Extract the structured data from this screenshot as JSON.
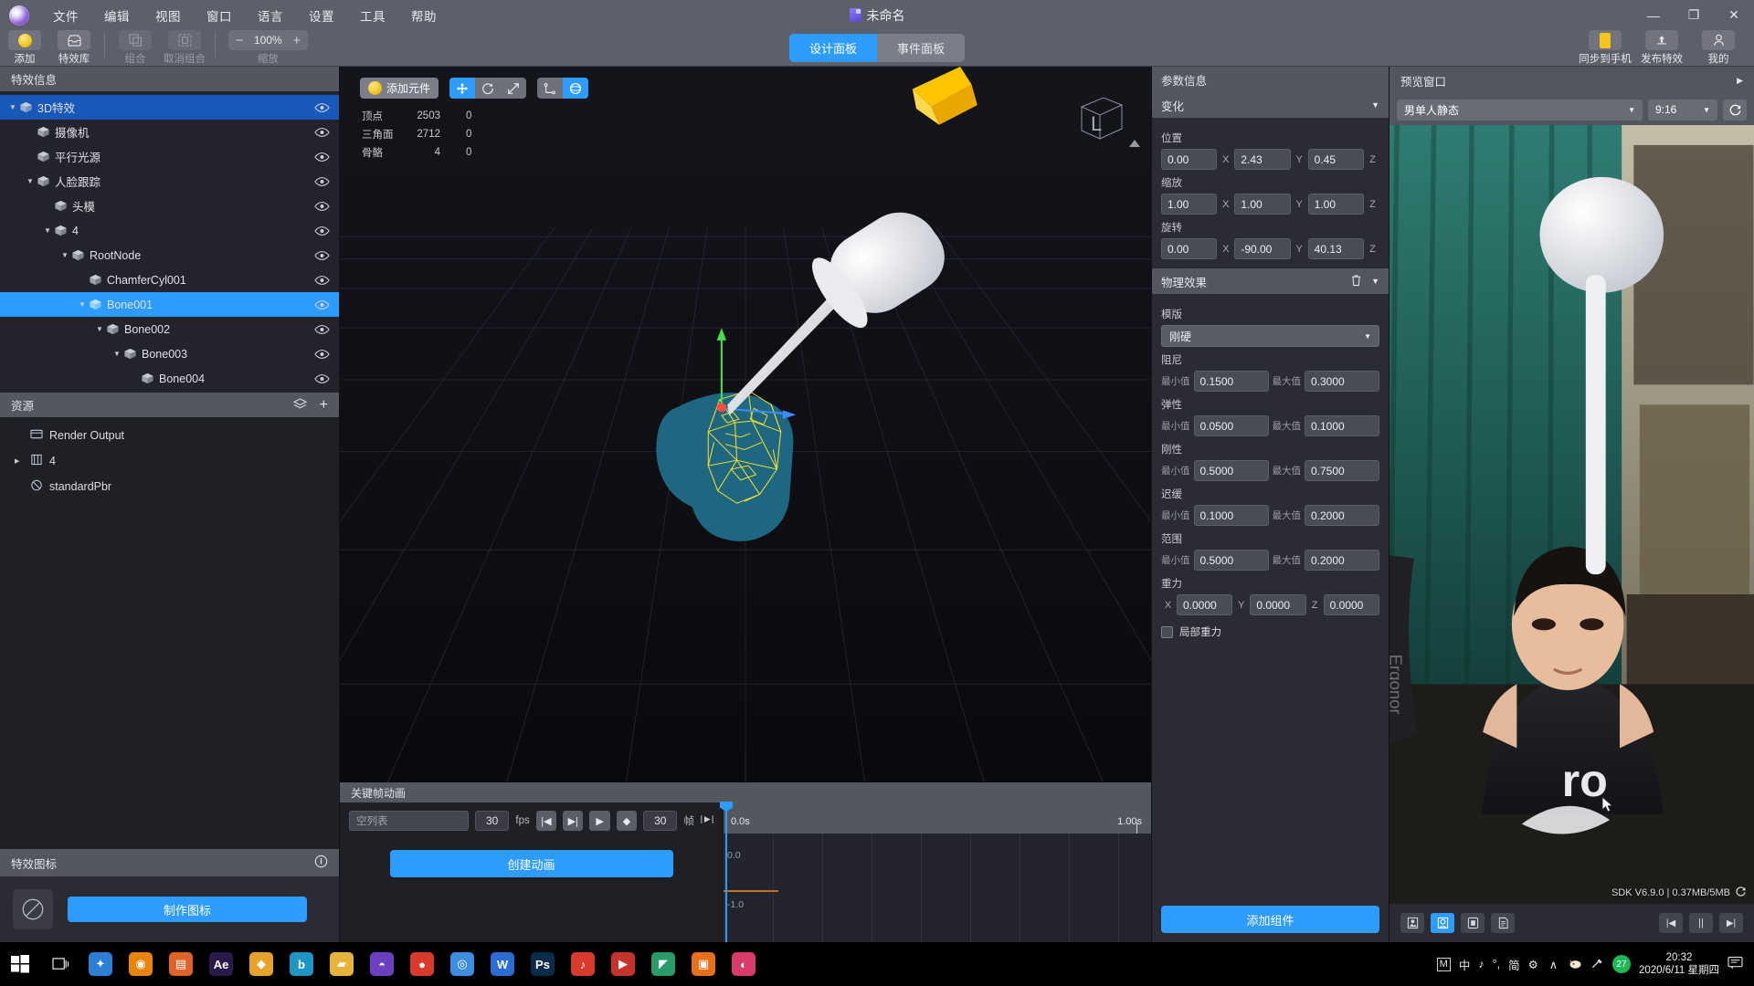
{
  "titlebar": {
    "menus": [
      "文件",
      "编辑",
      "视图",
      "窗口",
      "语言",
      "设置",
      "工具",
      "帮助"
    ],
    "document_title": "未命名",
    "minimize": "—",
    "maximize": "❐",
    "close": "✕"
  },
  "toolbar": {
    "items": [
      {
        "label": "添加",
        "icon": "coin-icon",
        "enabled": true
      },
      {
        "label": "特效库",
        "icon": "library-icon",
        "enabled": true
      },
      {
        "label": "组合",
        "icon": "group-icon",
        "enabled": false
      },
      {
        "label": "取消组合",
        "icon": "ungroup-icon",
        "enabled": false
      }
    ],
    "zoom_value": "100%",
    "zoom_minus": "−",
    "zoom_plus": "+",
    "zoom_label": "缩放",
    "tabs": [
      {
        "label": "设计面板",
        "active": true
      },
      {
        "label": "事件面板",
        "active": false
      }
    ],
    "right_items": [
      {
        "label": "同步到手机",
        "icon": "phone-icon"
      },
      {
        "label": "发布特效",
        "icon": "upload-icon"
      },
      {
        "label": "我的",
        "icon": "user-icon"
      }
    ]
  },
  "left_panel": {
    "header": "特效信息",
    "tree": [
      {
        "label": "3D特效",
        "depth": 0,
        "arrow": "▼",
        "state": "selected-dark",
        "eye": true
      },
      {
        "label": "摄像机",
        "depth": 1,
        "arrow": "",
        "state": "",
        "eye": true
      },
      {
        "label": "平行光源",
        "depth": 1,
        "arrow": "",
        "state": "",
        "eye": true
      },
      {
        "label": "人脸跟踪",
        "depth": 1,
        "arrow": "▼",
        "state": "",
        "eye": true
      },
      {
        "label": "头模",
        "depth": 2,
        "arrow": "",
        "state": "",
        "eye": true
      },
      {
        "label": "4",
        "depth": 2,
        "arrow": "▼",
        "state": "",
        "eye": true
      },
      {
        "label": "RootNode",
        "depth": 3,
        "arrow": "▼",
        "state": "",
        "eye": true
      },
      {
        "label": "ChamferCyl001",
        "depth": 4,
        "arrow": "",
        "state": "",
        "eye": true
      },
      {
        "label": "Bone001",
        "depth": 4,
        "arrow": "▼",
        "state": "selected",
        "eye": true
      },
      {
        "label": "Bone002",
        "depth": 5,
        "arrow": "▼",
        "state": "",
        "eye": true
      },
      {
        "label": "Bone003",
        "depth": 6,
        "arrow": "▼",
        "state": "",
        "eye": true
      },
      {
        "label": "Bone004",
        "depth": 7,
        "arrow": "",
        "state": "",
        "eye": true
      }
    ],
    "resources_header": "资源",
    "resources_icons": [
      "layers-icon",
      "plus-icon"
    ],
    "resources": [
      {
        "label": "Render Output",
        "icon": "render-icon",
        "arrow": ""
      },
      {
        "label": "4",
        "icon": "model-icon",
        "arrow": "▶"
      },
      {
        "label": "standardPbr",
        "icon": "material-icon",
        "arrow": ""
      }
    ],
    "goal_header": "特效图标",
    "goal_info_icon": "info-icon",
    "goal_button": "制作图标"
  },
  "viewport": {
    "add_element_button": "添加元件",
    "transform_tools": [
      {
        "name": "move-tool",
        "icon": "✥",
        "active": true
      },
      {
        "name": "rotate-tool",
        "icon": "↻",
        "active": false
      },
      {
        "name": "scale-tool",
        "icon": "⤢",
        "active": false
      }
    ],
    "space_tools": [
      {
        "name": "local-axis-tool",
        "icon": "⌖",
        "active": false
      },
      {
        "name": "world-axis-tool",
        "icon": "◍",
        "active": true
      }
    ],
    "stats": [
      {
        "key": "顶点",
        "value": "2503",
        "value2": "0"
      },
      {
        "key": "三角面",
        "value": "2712",
        "value2": "0"
      },
      {
        "key": "骨骼",
        "value": "4",
        "value2": "0"
      }
    ],
    "gizmo_label": "L"
  },
  "timeline": {
    "header": "关键帧动画",
    "clip_name_placeholder": "空列表",
    "fps_value": "30",
    "fps_label": "fps",
    "buttons": [
      {
        "name": "prev-frame-button",
        "icon": "|◀"
      },
      {
        "name": "next-frame-button",
        "icon": "▶|"
      },
      {
        "name": "play-button",
        "icon": "▶"
      },
      {
        "name": "add-keyframe-button",
        "icon": "◆"
      }
    ],
    "frame_value": "30",
    "frame_label": "帧",
    "loop_icon": "loop-icon",
    "create_button": "创建动画",
    "time_start": "0.0s",
    "time_end": "1.00s",
    "axis_labels": [
      "0.0",
      "-1.0"
    ]
  },
  "params": {
    "header": "参数信息",
    "transform": {
      "title": "变化",
      "collapse_icon": "▼",
      "position_label": "位置",
      "position": {
        "x": "0.00",
        "y": "2.43",
        "z": "0.45"
      },
      "scale_label": "缩放",
      "scale": {
        "x": "1.00",
        "y": "1.00",
        "z": "1.00"
      },
      "rotation_label": "旋转",
      "rotation": {
        "x": "0.00",
        "y": "-90.00",
        "z": "40.13"
      },
      "axis_x": "X",
      "axis_y": "Y",
      "axis_z": "Z"
    },
    "physics": {
      "title": "物理效果",
      "delete_icon": "trash-icon",
      "collapse_icon": "▼",
      "template_label": "模版",
      "template_value": "刚硬",
      "min_label": "最小值",
      "max_label": "最大值",
      "rows": [
        {
          "label": "阻尼",
          "min": "0.1500",
          "max": "0.3000"
        },
        {
          "label": "弹性",
          "min": "0.0500",
          "max": "0.1000"
        },
        {
          "label": "刚性",
          "min": "0.5000",
          "max": "0.7500"
        },
        {
          "label": "迟缓",
          "min": "0.1000",
          "max": "0.2000"
        },
        {
          "label": "范围",
          "min": "0.5000",
          "max": "0.2000"
        }
      ],
      "gravity_label": "重力",
      "gravity": {
        "x": "0.0000",
        "y": "0.0000",
        "z": "0.0000"
      },
      "gravity_axis_x": "X",
      "gravity_axis_y": "Y",
      "gravity_axis_z": "Z",
      "local_gravity_label": "局部重力",
      "local_gravity_checked": false
    },
    "add_component_button": "添加组件"
  },
  "preview": {
    "header": "预览窗口",
    "expand_icon": "▶",
    "source_value": "男单人静态",
    "ratio_value": "9:16",
    "refresh_icon": "refresh-icon",
    "sdk_text": "SDK V6.9.0  |  0.37MB/5MB",
    "sdk_refresh_icon": "refresh-icon",
    "mode_buttons": [
      {
        "name": "preview-mode-image",
        "icon": "image-icon",
        "active": false
      },
      {
        "name": "preview-mode-camera",
        "icon": "camera-icon",
        "active": true
      },
      {
        "name": "preview-mode-video",
        "icon": "video-icon",
        "active": false
      },
      {
        "name": "preview-mode-log",
        "icon": "log-icon",
        "active": false
      }
    ],
    "transport_buttons": [
      {
        "name": "preview-restart",
        "icon": "|◀"
      },
      {
        "name": "preview-pause",
        "icon": "||"
      },
      {
        "name": "preview-forward",
        "icon": "▶|"
      }
    ]
  },
  "taskbar": {
    "start_icon": "windows-icon",
    "taskview_icon": "task-view-icon",
    "apps": [
      {
        "name": "app-blue",
        "color": "#2c7fd4",
        "glyph": "✦"
      },
      {
        "name": "app-firefox",
        "color": "#e8840a",
        "glyph": "◉"
      },
      {
        "name": "app-orange-note",
        "color": "#e0632a",
        "glyph": "▤"
      },
      {
        "name": "app-ae",
        "color": "#2a1a4a",
        "glyph": "Ae"
      },
      {
        "name": "app-yellow",
        "color": "#e8a22a",
        "glyph": "◆"
      },
      {
        "name": "app-b",
        "color": "#2196c4",
        "glyph": "b"
      },
      {
        "name": "app-folder",
        "color": "#e8b33a",
        "glyph": "▰"
      },
      {
        "name": "app-purple",
        "color": "#6a3fc0",
        "glyph": "◓"
      },
      {
        "name": "app-red",
        "color": "#d93b2b",
        "glyph": "●"
      },
      {
        "name": "app-chrome",
        "color": "#3d8ee0",
        "glyph": "◎"
      },
      {
        "name": "app-wps",
        "color": "#2a6cd4",
        "glyph": "W"
      },
      {
        "name": "app-ps",
        "color": "#0a2b4a",
        "glyph": "Ps"
      },
      {
        "name": "app-music",
        "color": "#d93b2b",
        "glyph": "♪"
      },
      {
        "name": "app-player",
        "color": "#c4342a",
        "glyph": "▶"
      },
      {
        "name": "app-green",
        "color": "#2a9c6a",
        "glyph": "◤"
      },
      {
        "name": "app-editor",
        "color": "#e8701a",
        "glyph": "▣"
      },
      {
        "name": "app-pink",
        "color": "#d93b6b",
        "glyph": "◐"
      }
    ],
    "tray": {
      "ime_mark": "M",
      "ime_lang": "中",
      "ime_note": "♪",
      "ime_punct": "°,",
      "ime_simple": "简",
      "ime_gear": "⚙",
      "chevron": "∧",
      "badge_count": "27",
      "time": "20:32",
      "date": "2020/6/11 星期四",
      "notification_icon": "notification-icon"
    }
  }
}
